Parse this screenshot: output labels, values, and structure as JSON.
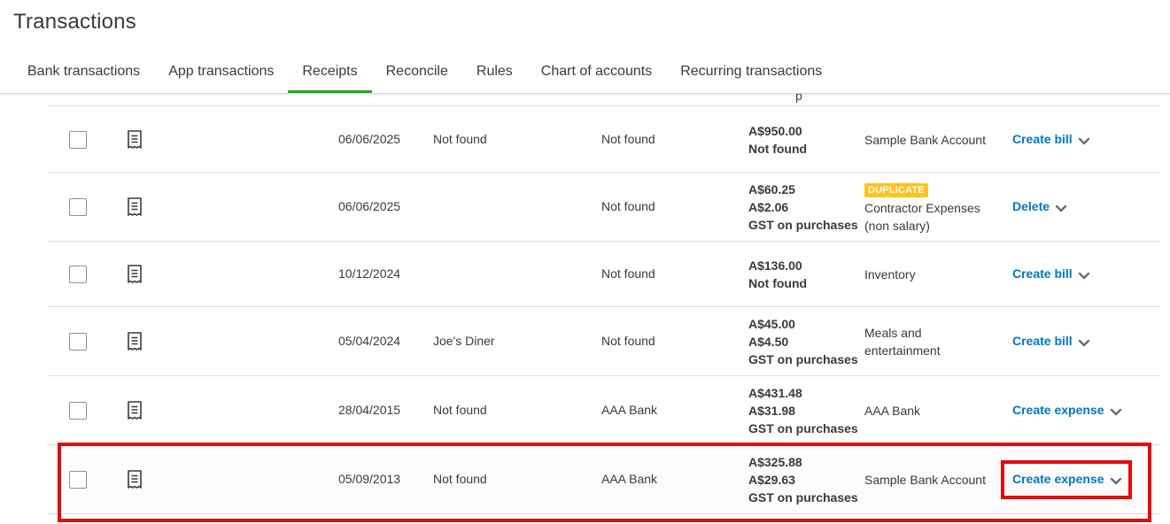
{
  "page": {
    "title": "Transactions"
  },
  "tabs": [
    {
      "label": "Bank transactions",
      "active": false
    },
    {
      "label": "App transactions",
      "active": false
    },
    {
      "label": "Receipts",
      "active": true
    },
    {
      "label": "Reconcile",
      "active": false
    },
    {
      "label": "Rules",
      "active": false
    },
    {
      "label": "Chart of accounts",
      "active": false
    },
    {
      "label": "Recurring transactions",
      "active": false
    }
  ],
  "partial_row": {
    "fragment": "p"
  },
  "rows": [
    {
      "date": "06/06/2025",
      "description": "Not found",
      "match": "Not found",
      "amount": "A$950.00",
      "tax_amount": "Not found",
      "tax_code": "",
      "badge": "",
      "account": "Sample Bank Account",
      "account_line2": "",
      "action": "Create bill"
    },
    {
      "date": "06/06/2025",
      "description": "",
      "match": "Not found",
      "amount": "A$60.25",
      "tax_amount": "A$2.06",
      "tax_code": "GST on purchases",
      "badge": "DUPLICATE",
      "account": "Contractor Expenses",
      "account_line2": "(non salary)",
      "action": "Delete"
    },
    {
      "date": "10/12/2024",
      "description": "",
      "match": "Not found",
      "amount": "A$136.00",
      "tax_amount": "Not found",
      "tax_code": "",
      "badge": "",
      "account": "Inventory",
      "account_line2": "",
      "action": "Create bill"
    },
    {
      "date": "05/04/2024",
      "description": "Joe's Diner",
      "match": "Not found",
      "amount": "A$45.00",
      "tax_amount": "A$4.50",
      "tax_code": "GST on purchases",
      "badge": "",
      "account": "Meals and",
      "account_line2": "entertainment",
      "action": "Create bill"
    },
    {
      "date": "28/04/2015",
      "description": "Not found",
      "match": "AAA Bank",
      "amount": "A$431.48",
      "tax_amount": "A$31.98",
      "tax_code": "GST on purchases",
      "badge": "",
      "account": "AAA Bank",
      "account_line2": "",
      "action": "Create expense"
    },
    {
      "date": "05/09/2013",
      "description": "Not found",
      "match": "AAA Bank",
      "amount": "A$325.88",
      "tax_amount": "A$29.63",
      "tax_code": "GST on purchases",
      "badge": "",
      "account": "Sample Bank Account",
      "account_line2": "",
      "action": "Create expense"
    }
  ],
  "colors": {
    "accent_green": "#2ca01c",
    "link_blue": "#0077c5",
    "badge_yellow": "#ffc220",
    "annotation_red": "#e30c0c"
  },
  "icons": {
    "receipt": "receipt-icon",
    "chevron": "chevron-down-icon"
  }
}
